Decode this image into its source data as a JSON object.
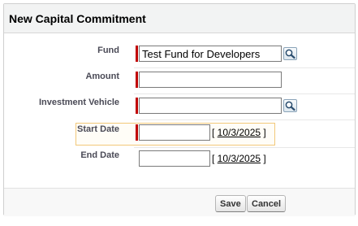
{
  "dialog": {
    "title": "New Capital Commitment"
  },
  "fields": {
    "fund": {
      "label": "Fund",
      "value": "Test Fund for Developers",
      "required": true
    },
    "amount": {
      "label": "Amount",
      "value": "",
      "required": true
    },
    "investment_vehicle": {
      "label": "Investment Vehicle",
      "value": "",
      "required": true
    },
    "start_date": {
      "label": "Start Date",
      "value": "",
      "required": true,
      "today_link": "10/3/2025"
    },
    "end_date": {
      "label": "End Date",
      "value": "",
      "required": false,
      "today_link": "10/3/2025"
    }
  },
  "buttons": {
    "save_label": "Save",
    "cancel_label": "Cancel"
  },
  "icons": {
    "lookup": "magnifier-lookup-icon"
  },
  "colors": {
    "required_bar": "#c00000",
    "highlight_border": "#f2c879",
    "header_bg": "#f2f3f3"
  }
}
